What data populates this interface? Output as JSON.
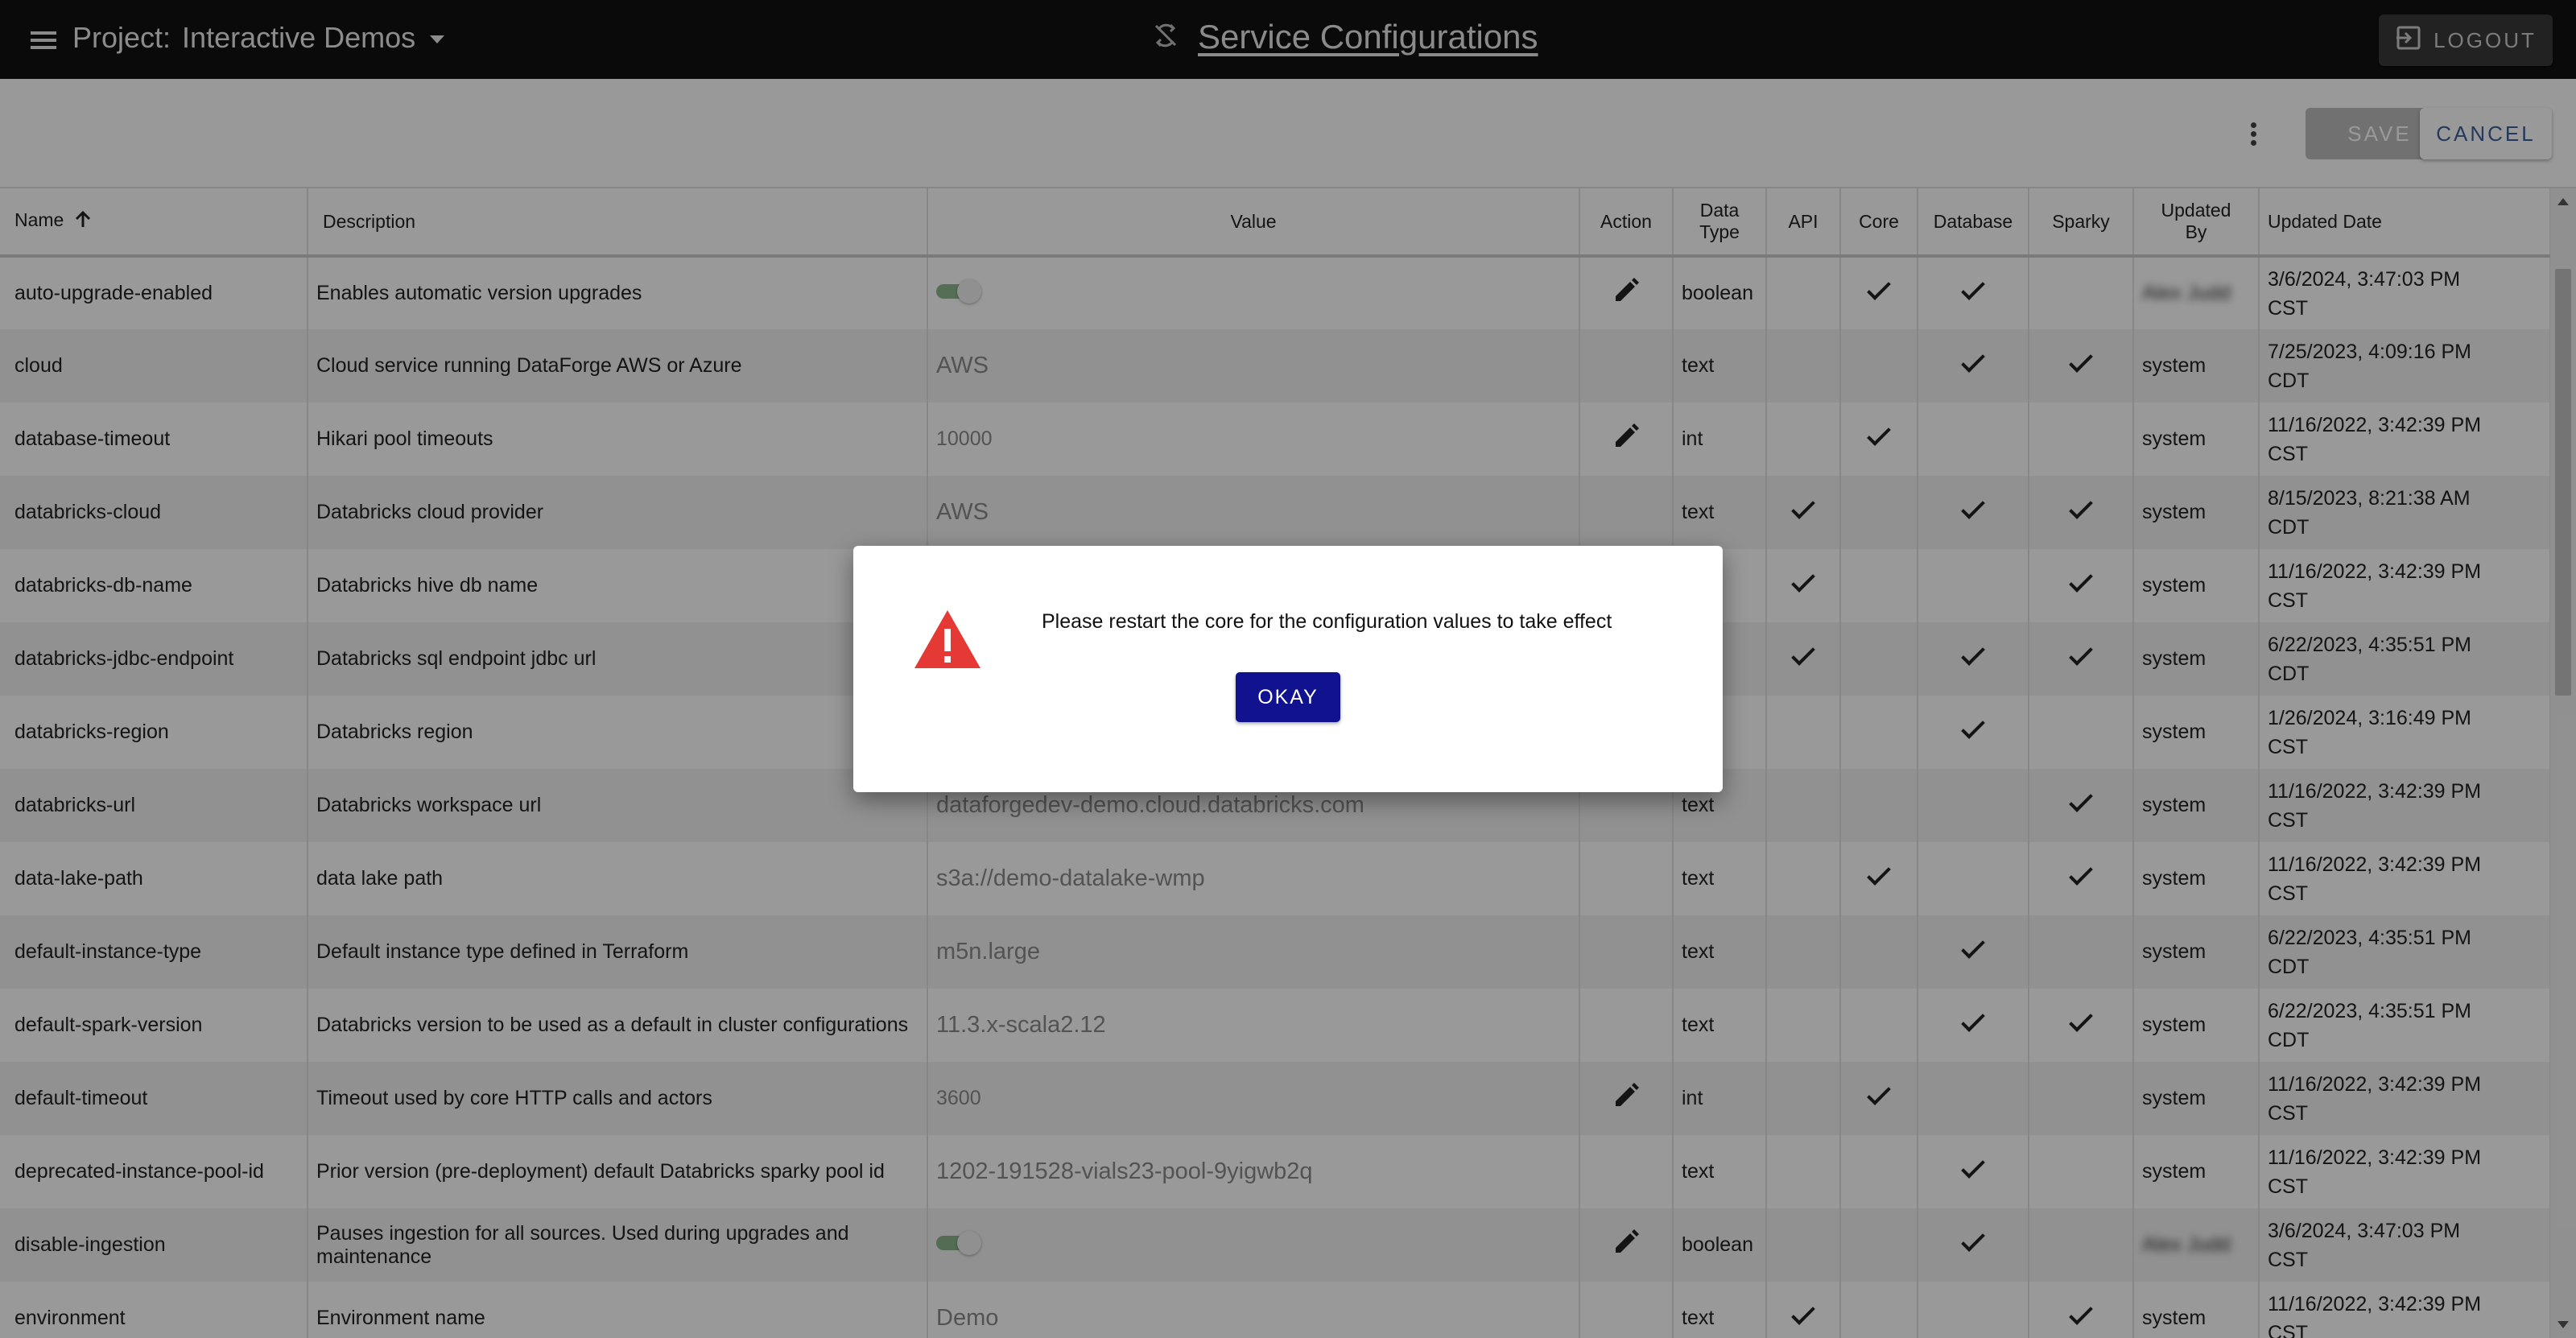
{
  "header": {
    "project_label": "Project:",
    "project_name": "Interactive Demos",
    "title": "Service Configurations",
    "logout_label": "LOGOUT"
  },
  "toolbar": {
    "save_label": "SAVE",
    "cancel_label": "CANCEL"
  },
  "table": {
    "columns": {
      "name": "Name",
      "description": "Description",
      "value": "Value",
      "action": "Action",
      "data_type_1": "Data",
      "data_type_2": "Type",
      "api": "API",
      "core": "Core",
      "database": "Database",
      "sparky": "Sparky",
      "updated_by_1": "Updated",
      "updated_by_2": "By",
      "updated_date": "Updated Date"
    },
    "rows": [
      {
        "name": "auto-upgrade-enabled",
        "description": "Enables automatic version upgrades",
        "value": "",
        "toggle": true,
        "edit": true,
        "type": "boolean",
        "api": false,
        "core": true,
        "database": true,
        "sparky": false,
        "updated_by": "Alex Judd",
        "updated_by_blurred": true,
        "date1": "3/6/2024, 3:47:03 PM",
        "date2": "CST"
      },
      {
        "name": "cloud",
        "description": "Cloud service running DataForge AWS or Azure",
        "value": "AWS",
        "toggle": false,
        "edit": false,
        "type": "text",
        "api": false,
        "core": false,
        "database": true,
        "sparky": true,
        "updated_by": "system",
        "updated_by_blurred": false,
        "date1": "7/25/2023, 4:09:16 PM",
        "date2": "CDT"
      },
      {
        "name": "database-timeout",
        "description": "Hikari pool timeouts",
        "value": "10000",
        "small": true,
        "toggle": false,
        "edit": true,
        "type": "int",
        "api": false,
        "core": true,
        "database": false,
        "sparky": false,
        "updated_by": "system",
        "updated_by_blurred": false,
        "date1": "11/16/2022, 3:42:39 PM",
        "date2": "CST"
      },
      {
        "name": "databricks-cloud",
        "description": "Databricks cloud provider",
        "value": "AWS",
        "toggle": false,
        "edit": false,
        "type": "text",
        "api": true,
        "core": false,
        "database": true,
        "sparky": true,
        "updated_by": "system",
        "updated_by_blurred": false,
        "date1": "8/15/2023, 8:21:38 AM",
        "date2": "CDT"
      },
      {
        "name": "databricks-db-name",
        "description": "Databricks hive db name",
        "value": "",
        "toggle": false,
        "edit": false,
        "type": "",
        "api": true,
        "core": false,
        "database": false,
        "sparky": true,
        "updated_by": "system",
        "updated_by_blurred": false,
        "date1": "11/16/2022, 3:42:39 PM",
        "date2": "CST"
      },
      {
        "name": "databricks-jdbc-endpoint",
        "description": "Databricks sql endpoint jdbc url",
        "value": "",
        "toggle": false,
        "edit": false,
        "type": "",
        "api": true,
        "core": false,
        "database": true,
        "sparky": true,
        "updated_by": "system",
        "updated_by_blurred": false,
        "date1": "6/22/2023, 4:35:51 PM",
        "date2": "CDT"
      },
      {
        "name": "databricks-region",
        "description": "Databricks region",
        "value": "",
        "toggle": false,
        "edit": false,
        "type": "",
        "api": false,
        "core": false,
        "database": true,
        "sparky": false,
        "updated_by": "system",
        "updated_by_blurred": false,
        "date1": "1/26/2024, 3:16:49 PM",
        "date2": "CST"
      },
      {
        "name": "databricks-url",
        "description": "Databricks workspace url",
        "value": "dataforgedev-demo.cloud.databricks.com",
        "toggle": false,
        "edit": false,
        "type": "text",
        "api": false,
        "core": false,
        "database": false,
        "sparky": true,
        "updated_by": "system",
        "updated_by_blurred": false,
        "date1": "11/16/2022, 3:42:39 PM",
        "date2": "CST"
      },
      {
        "name": "data-lake-path",
        "description": "data lake path",
        "value": "s3a://demo-datalake-wmp",
        "toggle": false,
        "edit": false,
        "type": "text",
        "api": false,
        "core": true,
        "database": false,
        "sparky": true,
        "updated_by": "system",
        "updated_by_blurred": false,
        "date1": "11/16/2022, 3:42:39 PM",
        "date2": "CST"
      },
      {
        "name": "default-instance-type",
        "description": "Default instance type defined in Terraform",
        "value": "m5n.large",
        "toggle": false,
        "edit": false,
        "type": "text",
        "api": false,
        "core": false,
        "database": true,
        "sparky": false,
        "updated_by": "system",
        "updated_by_blurred": false,
        "date1": "6/22/2023, 4:35:51 PM",
        "date2": "CDT"
      },
      {
        "name": "default-spark-version",
        "description": "Databricks version to be used as a default in cluster configurations",
        "value": "11.3.x-scala2.12",
        "toggle": false,
        "edit": false,
        "type": "text",
        "api": false,
        "core": false,
        "database": true,
        "sparky": true,
        "updated_by": "system",
        "updated_by_blurred": false,
        "date1": "6/22/2023, 4:35:51 PM",
        "date2": "CDT"
      },
      {
        "name": "default-timeout",
        "description": "Timeout used by core HTTP calls and actors",
        "value": "3600",
        "small": true,
        "toggle": false,
        "edit": true,
        "type": "int",
        "api": false,
        "core": true,
        "database": false,
        "sparky": false,
        "updated_by": "system",
        "updated_by_blurred": false,
        "date1": "11/16/2022, 3:42:39 PM",
        "date2": "CST"
      },
      {
        "name": "deprecated-instance-pool-id",
        "description": "Prior version (pre-deployment) default Databricks sparky pool id",
        "value": "1202-191528-vials23-pool-9yigwb2q",
        "toggle": false,
        "edit": false,
        "type": "text",
        "api": false,
        "core": false,
        "database": true,
        "sparky": false,
        "updated_by": "system",
        "updated_by_blurred": false,
        "date1": "11/16/2022, 3:42:39 PM",
        "date2": "CST"
      },
      {
        "name": "disable-ingestion",
        "description": "Pauses ingestion for all sources. Used during upgrades and maintenance",
        "value": "",
        "toggle": true,
        "edit": true,
        "type": "boolean",
        "api": false,
        "core": false,
        "database": true,
        "sparky": false,
        "updated_by": "Alex Judd",
        "updated_by_blurred": true,
        "date1": "3/6/2024, 3:47:03 PM",
        "date2": "CST"
      },
      {
        "name": "environment",
        "description": "Environment name",
        "value": "Demo",
        "toggle": false,
        "edit": false,
        "type": "text",
        "api": true,
        "core": false,
        "database": false,
        "sparky": true,
        "updated_by": "system",
        "updated_by_blurred": false,
        "date1": "11/16/2022, 3:42:39 PM",
        "date2": "CST"
      }
    ]
  },
  "dialog": {
    "message": "Please restart the core for the configuration values to take effect",
    "okay_label": "OKAY"
  },
  "colors": {
    "appbar": "#121212",
    "dialog_button": "#11128f",
    "warning": "#e53935",
    "toggle_on": "#5e9a5f"
  }
}
